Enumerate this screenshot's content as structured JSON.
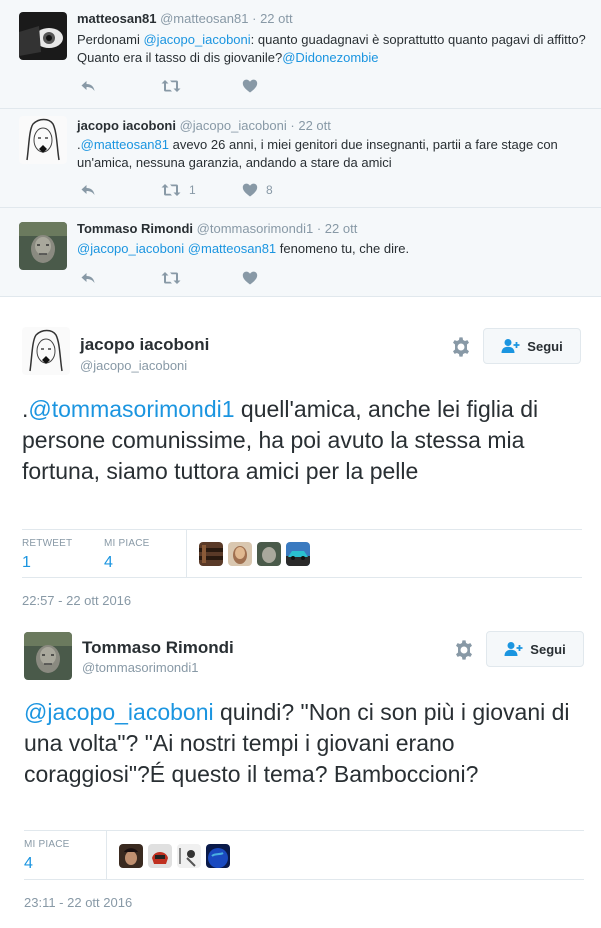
{
  "replies": [
    {
      "name": "matteosan81",
      "handle": "@matteosan81",
      "date": "22 ott",
      "text": [
        {
          "t": "Perdonami "
        },
        {
          "t": "@jacopo_iacoboni",
          "m": true
        },
        {
          "t": ": quanto guadagnavi è soprattutto quanto pagavi di affitto? Quanto era il tasso di dis giovanile?"
        },
        {
          "t": "@Didonezombie",
          "m": true
        }
      ],
      "retweets": "",
      "likes": ""
    },
    {
      "name": "jacopo iacoboni",
      "handle": "@jacopo_iacoboni",
      "date": "22 ott",
      "text": [
        {
          "t": "."
        },
        {
          "t": "@matteosan81",
          "m": true
        },
        {
          "t": " avevo 26 anni, i miei genitori due insegnanti, partii a fare stage con un'amica, nessuna garanzia, andando a stare da amici"
        }
      ],
      "retweets": "1",
      "likes": "8"
    },
    {
      "name": "Tommaso Rimondi",
      "handle": "@tommasorimondi1",
      "date": "22 ott",
      "text": [
        {
          "t": "@jacopo_iacoboni",
          "m": true
        },
        {
          "t": " "
        },
        {
          "t": "@matteosan81",
          "m": true
        },
        {
          "t": " fenomeno tu, che dire."
        }
      ],
      "retweets": "",
      "likes": ""
    }
  ],
  "tweet1": {
    "name": "jacopo iacoboni",
    "handle": "@jacopo_iacoboni",
    "follow_label": "Segui",
    "text": [
      {
        "t": "."
      },
      {
        "t": "@tommasorimondi1",
        "m": true
      },
      {
        "t": " quell'amica, anche lei figlia di persone comunissime, ha poi avuto la stessa mia fortuna, siamo tuttora amici per la pelle"
      }
    ],
    "retweet_label": "RETWEET",
    "retweet_count": "1",
    "like_label": "MI PIACE",
    "like_count": "4",
    "timestamp": "22:57 - 22 ott 2016"
  },
  "tweet2": {
    "name": "Tommaso Rimondi",
    "handle": "@tommasorimondi1",
    "follow_label": "Segui",
    "text": [
      {
        "t": "@jacopo_iacoboni",
        "m": true
      },
      {
        "t": " quindi? \"Non ci son più i giovani di una volta\"? \"Ai nostri tempi i giovani erano coraggiosi\"?É questo il tema? Bamboccioni?"
      }
    ],
    "like_label": "MI PIACE",
    "like_count": "4",
    "timestamp": "23:11 - 22 ott 2016"
  },
  "colors": {
    "link": "#1b95e0",
    "muted": "#8899a6",
    "text": "#292f33",
    "reply_bg": "#f5f8fa",
    "border": "#e1e8ed"
  },
  "icons": [
    "reply-icon",
    "retweet-icon",
    "like-icon",
    "gear-icon",
    "follow-user-icon"
  ]
}
